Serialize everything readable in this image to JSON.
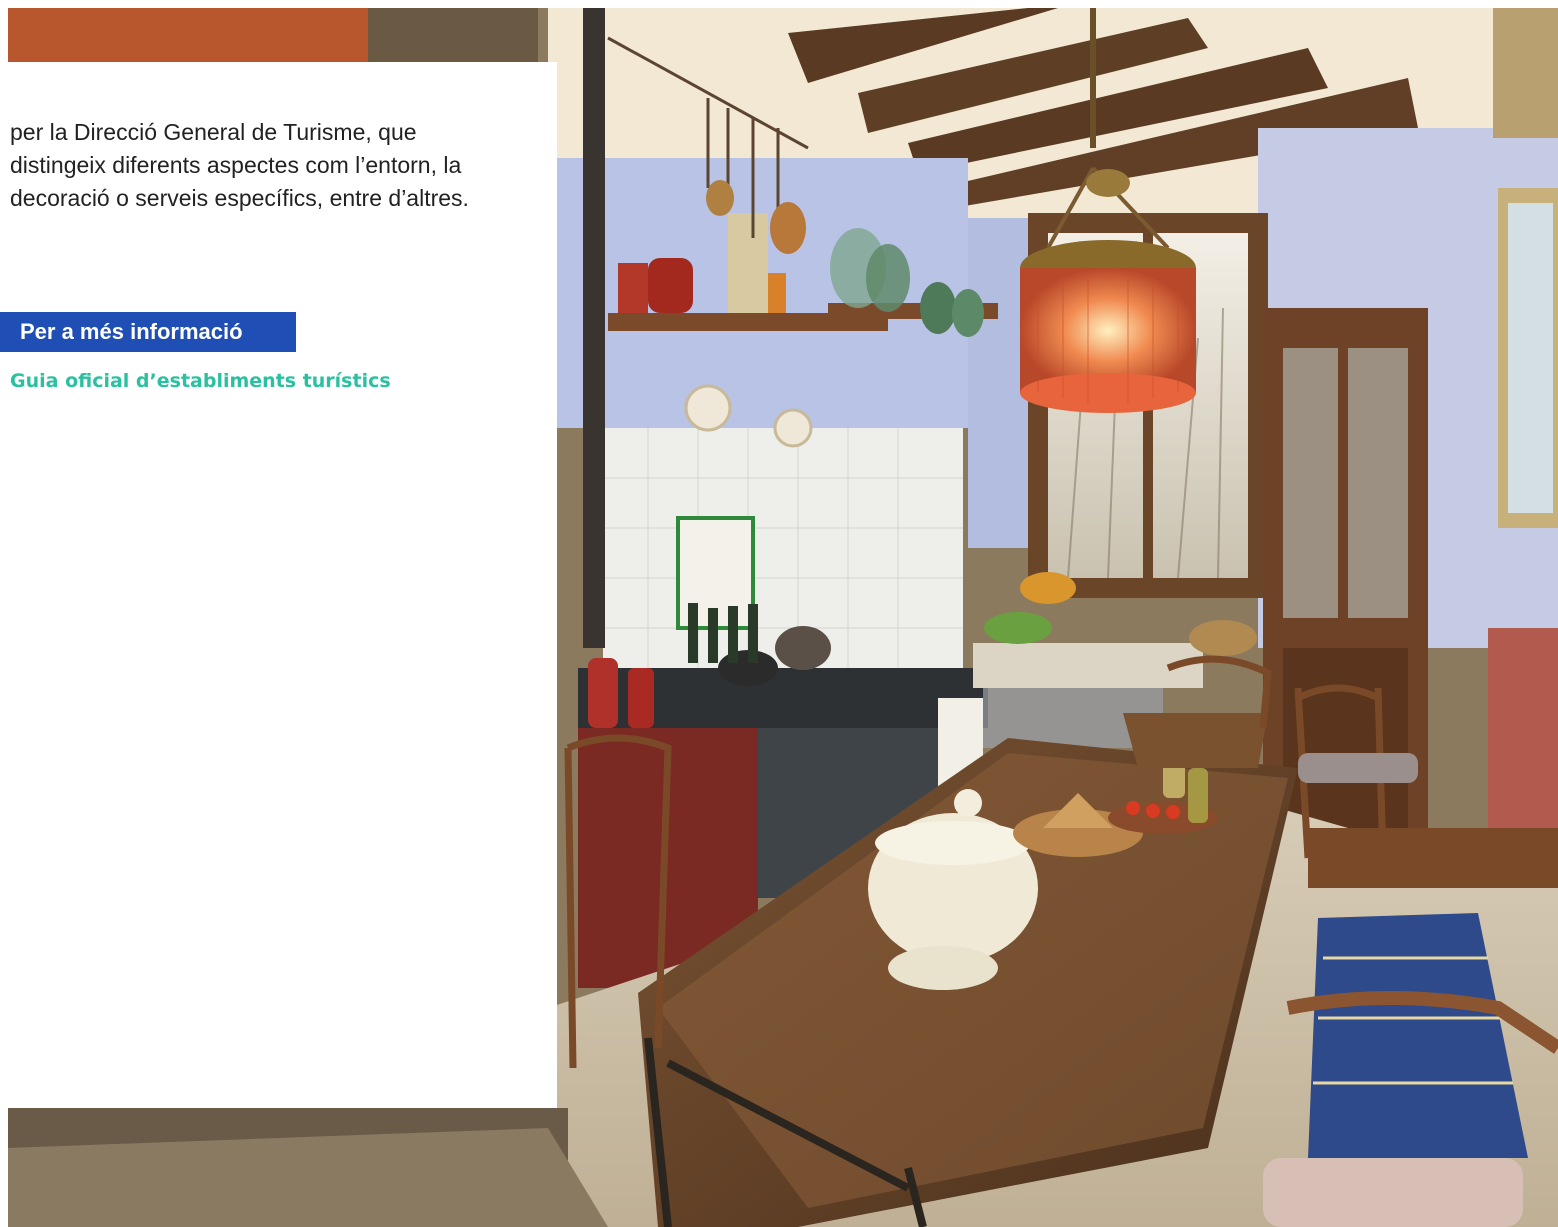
{
  "card": {
    "description": "per la Direcció General de Turisme, que distingeix diferents aspectes com l’entorn, la decoració o serveis específics, entre d’altres.",
    "info_heading": "Per a més informació",
    "info_link": "Guia oficial d’establiments turístics"
  },
  "colors": {
    "heading_background": "#1f4fb5",
    "link": "#2bc0a0",
    "lamp": "#e8643c",
    "wall": "#b9c3e6"
  },
  "photo": {
    "subject": "rustic kitchen interior with wooden table, hanging lamp, shelves and window"
  }
}
